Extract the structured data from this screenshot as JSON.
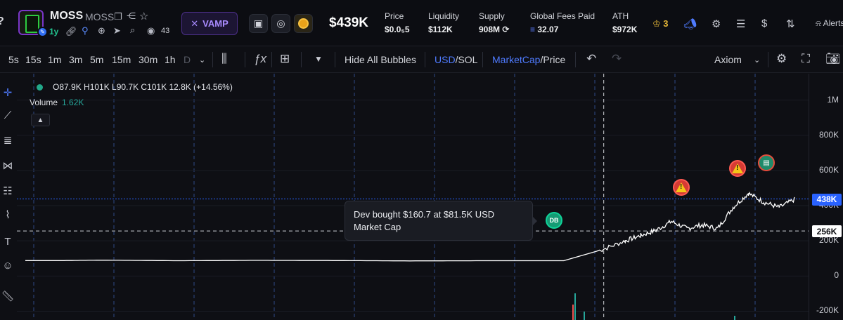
{
  "header": {
    "edge_glyph": "?",
    "token_name": "MOSS",
    "token_ticker": "MOSS",
    "token_age": "1y",
    "holders_count": "43",
    "vamp_label": "VAMP",
    "market_cap": "$439K",
    "stats": [
      {
        "label": "Price",
        "value": "$0.0₅5"
      },
      {
        "label": "Liquidity",
        "value": "$112K"
      },
      {
        "label": "Supply",
        "value": "908M"
      },
      {
        "label": "Global Fees Paid",
        "value": "32.07"
      },
      {
        "label": "ATH",
        "value": "$972K"
      }
    ],
    "crown_count": "3",
    "alerts_label": "Alerts"
  },
  "toolbar": {
    "intervals": [
      "5s",
      "15s",
      "1m",
      "3m",
      "5m",
      "15m",
      "30m",
      "1h",
      "D"
    ],
    "hide_bubbles": "Hide All Bubbles",
    "currency_active": "USD",
    "currency_other": "/SOL",
    "metric_active": "MarketCap",
    "metric_other": "/Price",
    "provider": "Axiom"
  },
  "legend": {
    "ohlc": "O87.9K H101K L90.7K C101K 12.8K (+14.56%)",
    "volume_label": "Volume",
    "volume_value": "1.62K"
  },
  "tooltip": {
    "line1": "Dev bought $160.7 at $81.5K USD",
    "line2": "Market Cap"
  },
  "bubbles": {
    "dev": "DB"
  },
  "axis": {
    "ticks": [
      "1M",
      "800K",
      "600K",
      "400K",
      "200K",
      "0",
      "-200K"
    ],
    "last_price_tag": "438K",
    "crosshair_tag": "256K"
  },
  "chart_data": {
    "type": "line",
    "series": [
      {
        "x": [
          0,
          5,
          10,
          20,
          30,
          40,
          50,
          60,
          65,
          70,
          75,
          78,
          80,
          82,
          84,
          86,
          88,
          90,
          92,
          94,
          96,
          98,
          100
        ],
        "values": [
          88,
          88,
          90,
          87,
          89,
          88,
          86,
          87,
          87,
          87,
          150,
          200,
          230,
          260,
          310,
          270,
          290,
          270,
          390,
          470,
          420,
          390,
          435
        ]
      }
    ],
    "ylim": [
      -250,
      1150
    ],
    "grid": true,
    "last_value": 438,
    "crosshair_value": 256,
    "colors": {
      "line": "#ffffff",
      "last_price": "#2962ff",
      "volume_up": "#26a69a",
      "volume_down": "#ef5350"
    }
  }
}
